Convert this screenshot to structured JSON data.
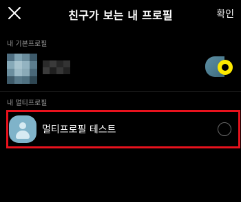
{
  "header": {
    "title": "친구가 보는 내 프로필",
    "confirm_label": "확인",
    "close_icon": "close-icon"
  },
  "basic_section": {
    "label": "내 기본프로필",
    "profile": {
      "selected": true,
      "blurred": true,
      "radio_color": "#fde900"
    }
  },
  "multi_section": {
    "label": "내 멀티프로필",
    "profile": {
      "name": "멀티프로필 테스트",
      "selected": false,
      "avatar_color": "#7fb3c9",
      "highlight_color": "#e8121d"
    }
  }
}
